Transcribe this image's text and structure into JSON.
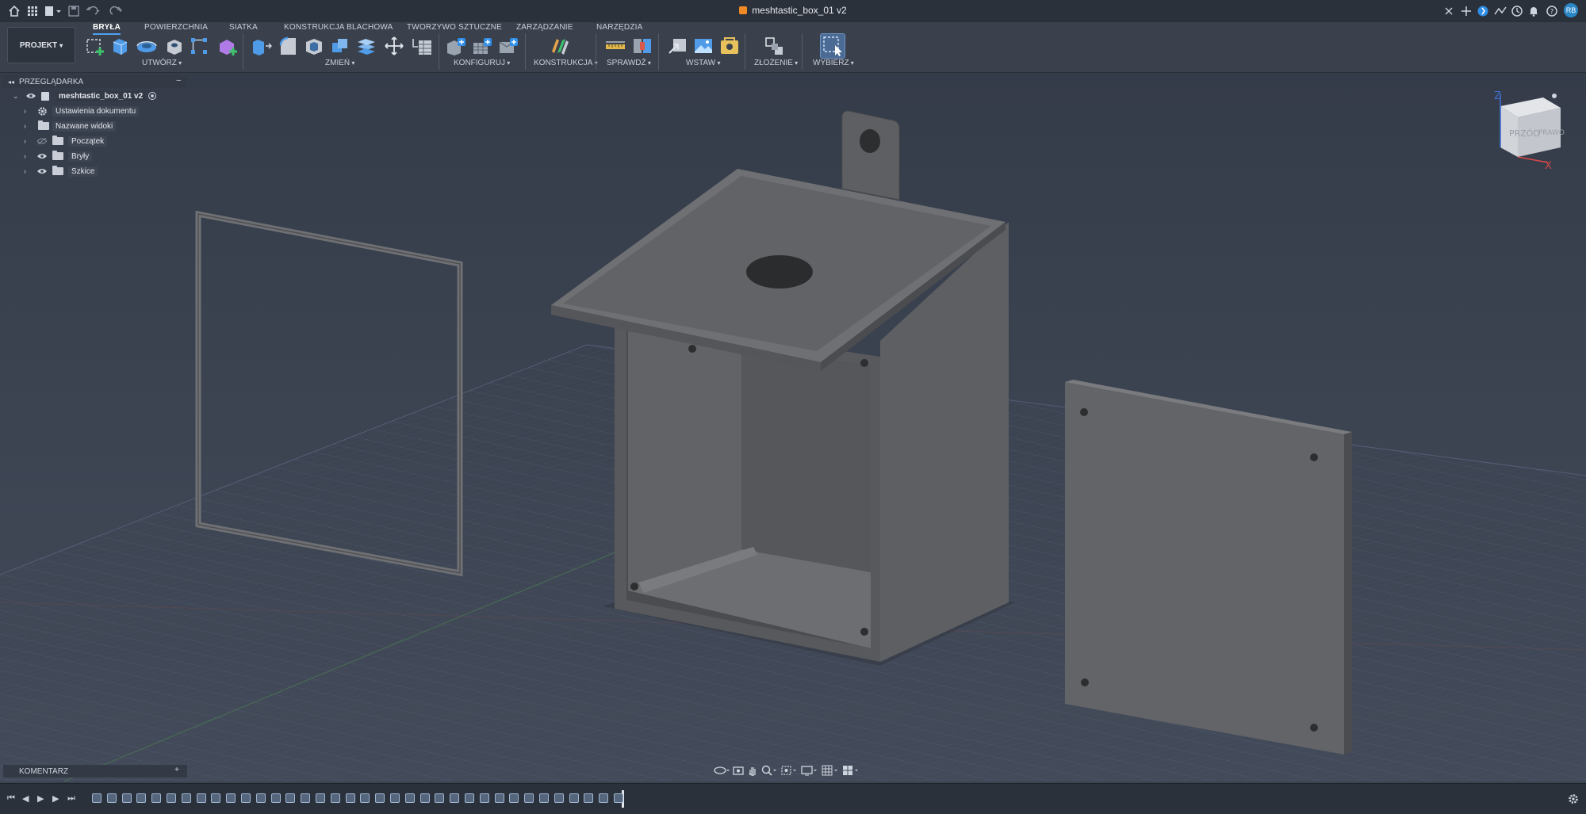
{
  "titlebar": {
    "document_title": "meshtastic_box_01 v2",
    "user_initials": "RB"
  },
  "ribbon": {
    "project_label": "PROJEKT",
    "tabs": [
      {
        "label": "BRYŁA",
        "active": true
      },
      {
        "label": "POWIERZCHNIA"
      },
      {
        "label": "SIATKA"
      },
      {
        "label": "KONSTRUKCJA BLACHOWA"
      },
      {
        "label": "TWORZYWO SZTUCZNE"
      },
      {
        "label": "ZARZĄDZANIE"
      },
      {
        "label": "NARZĘDZIA"
      }
    ],
    "groups": [
      "UTWÓRZ",
      "ZMIEŃ",
      "KONFIGURUJ",
      "KONSTRUKCJA",
      "SPRAWDŹ",
      "WSTAW",
      "ZŁOŻENIE",
      "WYBIERZ"
    ]
  },
  "browser": {
    "header": "PRZEGLĄDARKA",
    "root": "meshtastic_box_01 v2",
    "items": [
      {
        "label": "Ustawienia dokumentu",
        "icon": "gear-icon"
      },
      {
        "label": "Nazwane widoki",
        "icon": "folder-icon"
      },
      {
        "label": "Początek",
        "icon": "folder-icon",
        "hidden": true
      },
      {
        "label": "Bryły",
        "icon": "folder-icon"
      },
      {
        "label": "Szkice",
        "icon": "folder-icon"
      }
    ]
  },
  "viewcube": {
    "front_label": "PRZÓD",
    "right_label": "PRAWO",
    "axis_z": "Z",
    "axis_x": "X"
  },
  "comments": {
    "label": "KOMENTARZ",
    "add_label": "+"
  },
  "colors": {
    "accent": "#4ea1f0",
    "brand_orange": "#f08a24",
    "viewport_bg": "#3b4250",
    "model_gray": "#6b6d70"
  }
}
